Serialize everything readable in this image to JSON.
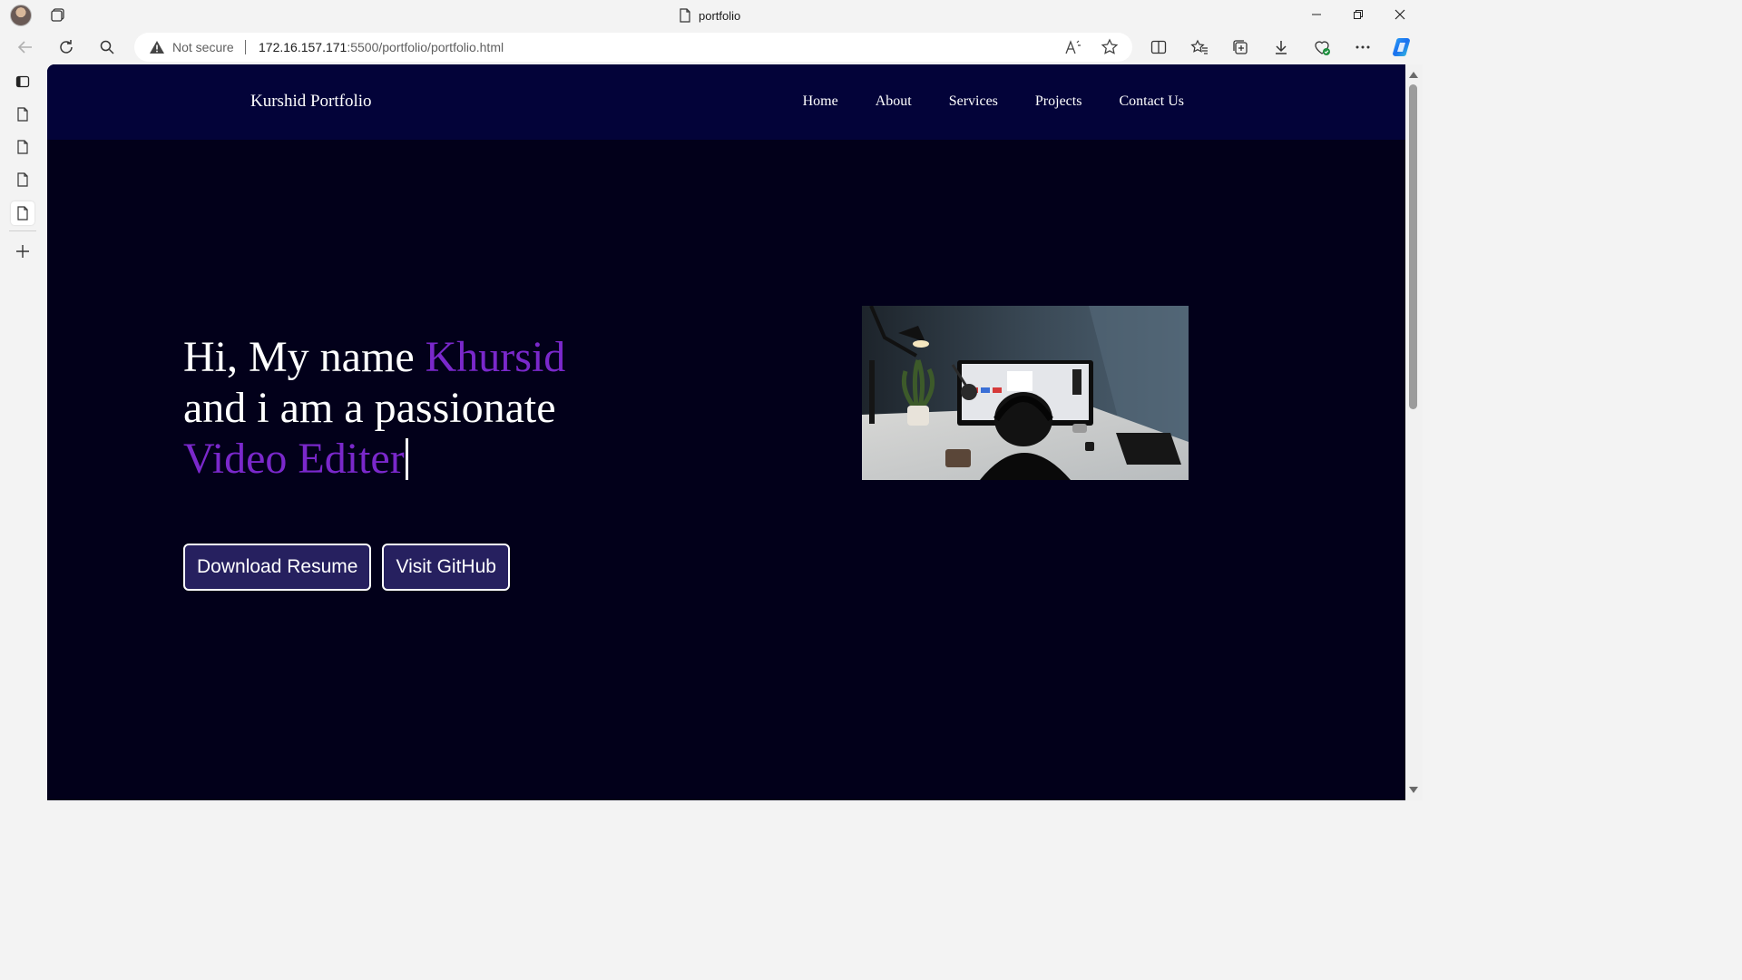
{
  "browser": {
    "tab_title": "portfolio",
    "security_label": "Not secure",
    "url_host": "172.16.157.171",
    "url_rest": ":5500/portfolio/portfolio.html"
  },
  "site": {
    "brand": "Kurshid Portfolio",
    "nav": [
      "Home",
      "About",
      "Services",
      "Projects",
      "Contact Us"
    ],
    "hero": {
      "line1_prefix": "Hi, My name ",
      "name": "Khursid",
      "line2": "and i am a passionate",
      "role": "Video Editer"
    },
    "buttons": {
      "resume": "Download Resume",
      "github": "Visit GitHub"
    }
  },
  "colors": {
    "nav_bg": "#030339",
    "page_bg": "#02001a",
    "accent": "#7a28cb",
    "button_bg": "#26205f"
  },
  "icons": {
    "browser": [
      "profile-avatar",
      "tab-actions-icon",
      "page-icon",
      "minimize-icon",
      "restore-icon",
      "close-icon",
      "back-icon",
      "refresh-icon",
      "search-icon",
      "warning-icon",
      "read-aloud-icon",
      "favorite-star-icon",
      "split-screen-icon",
      "favorites-icon",
      "collections-icon",
      "downloads-icon",
      "browser-essentials-icon",
      "more-icon",
      "copilot-icon"
    ],
    "sidebar": [
      "vertical-tabs-icon",
      "page-icon",
      "page-icon",
      "page-icon",
      "page-icon",
      "plus-icon"
    ]
  }
}
